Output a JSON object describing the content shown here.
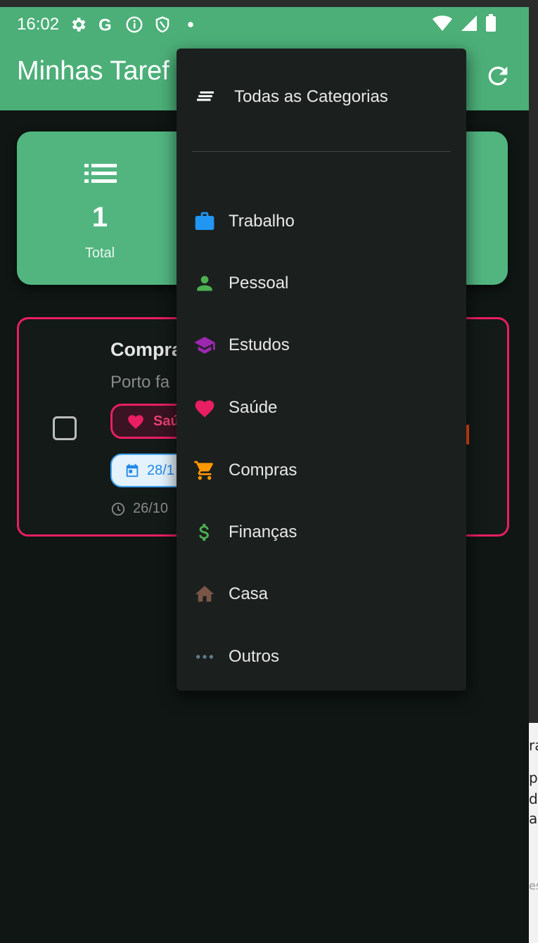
{
  "status_bar": {
    "time": "16:02",
    "left_icons": [
      "gear-icon",
      "google-icon",
      "info-icon",
      "shield-icon",
      "dot-icon"
    ],
    "right_icons": [
      "wifi-icon",
      "signal-icon",
      "battery-icon"
    ]
  },
  "app_bar": {
    "title": "Minhas Taref",
    "refresh_icon": "refresh-icon",
    "color": "#4caf78"
  },
  "stats": {
    "total_value": "1",
    "total_label": "Total",
    "icon": "list-icon"
  },
  "task": {
    "title": "Compra",
    "description": "Porto fa",
    "category_chip": "Saú",
    "due_chip": "28/1",
    "created": "26/10",
    "accent": "#e91e63"
  },
  "category_menu": {
    "all_label": "Todas as Categorias",
    "items": [
      {
        "label": "Trabalho",
        "icon": "briefcase-icon",
        "color": "#2196f3"
      },
      {
        "label": "Pessoal",
        "icon": "person-icon",
        "color": "#4caf50"
      },
      {
        "label": "Estudos",
        "icon": "graduation-cap-icon",
        "color": "#9c27b0"
      },
      {
        "label": "Saúde",
        "icon": "heart-icon",
        "color": "#e91e63"
      },
      {
        "label": "Compras",
        "icon": "cart-icon",
        "color": "#ff9800"
      },
      {
        "label": "Finanças",
        "icon": "dollar-icon",
        "color": "#4caf50"
      },
      {
        "label": "Casa",
        "icon": "home-icon",
        "color": "#795548"
      },
      {
        "label": "Outros",
        "icon": "more-horiz-icon",
        "color": "#607d8b"
      }
    ]
  },
  "side_panel": {
    "fragments": [
      "ra",
      "p",
      "di",
      "a",
      "es"
    ]
  }
}
